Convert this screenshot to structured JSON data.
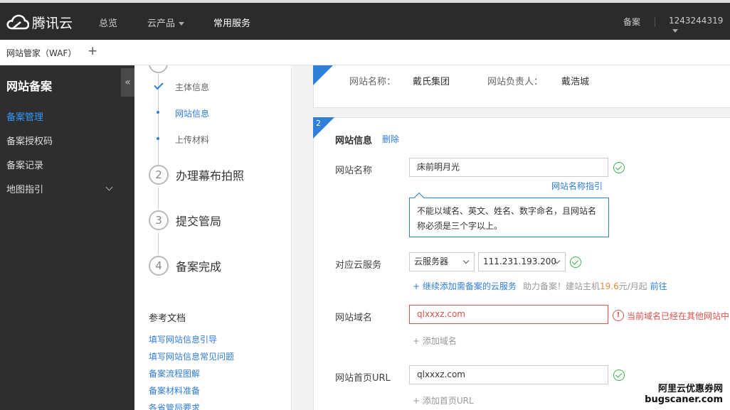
{
  "topbar": {
    "brand": "腾讯云",
    "nav": [
      "总览",
      "云产品",
      "常用服务"
    ],
    "beian": "备案",
    "account": "1243244319"
  },
  "tabbar": {
    "tab": "网站管家（WAF）",
    "add": "+"
  },
  "sidebar": {
    "title": "网站备案",
    "collapse": "«",
    "items": [
      "备案管理",
      "备案授权码",
      "备案记录",
      "地图指引"
    ]
  },
  "steps": {
    "substeps": [
      "主体信息",
      "网站信息",
      "上传材料"
    ],
    "main": [
      {
        "num": "2",
        "label": "办理幕布拍照"
      },
      {
        "num": "3",
        "label": "提交管局"
      },
      {
        "num": "4",
        "label": "备案完成"
      }
    ],
    "ref_title": "参考文档",
    "ref_links": [
      "填写网站信息引导",
      "填写网站信息常见问题",
      "备案流程图解",
      "备案材料准备",
      "各省管局要求"
    ]
  },
  "summary": {
    "site_name_label": "网站名称：",
    "site_name": "戴氏集团",
    "owner_label": "网站负责人：",
    "owner": "戴浩城"
  },
  "form": {
    "section_num": "2",
    "title": "网站信息",
    "delete": "删除",
    "name_label": "网站名称",
    "name_value": "床前明月光",
    "name_guide": "网站名称指引",
    "tip": "不能以域名、英文、姓名、数字命名，且网站名称必须是三个字以上。",
    "service_label": "对应云服务",
    "service_type": "云服务器",
    "service_ip": "111.231.193.200",
    "add_service": "+ 继续添加需备案的云服务",
    "hint_a": "助力备案！建站主机",
    "hint_price": "19.6",
    "hint_b": "元/月起",
    "hint_go": "前往",
    "domain_label": "网站域名",
    "domain_value": "qlxxxz.com",
    "domain_error": "当前域名已经在其他网站中",
    "add_domain": "+ 添加域名",
    "homepage_label": "网站首页URL",
    "homepage_value": "qlxxxz.com",
    "add_homepage": "+ 添加首页URL"
  },
  "watermark": {
    "line1": "阿里云优惠券网",
    "line2": "bugscaner.com"
  }
}
